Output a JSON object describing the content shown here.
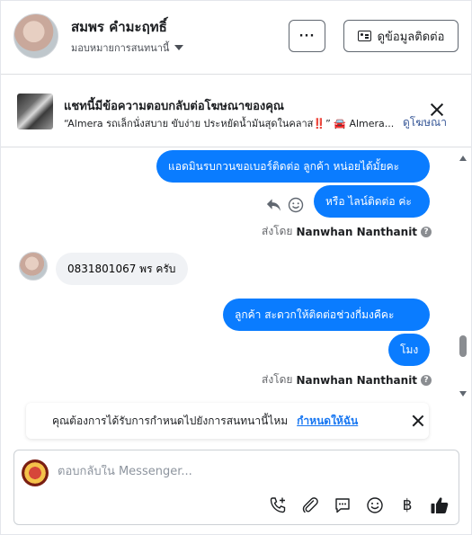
{
  "header": {
    "contact_name": "สมพร คํามะฤทธิ์",
    "assign_label": "มอบหมายการสนทนานี้",
    "more_label": "···",
    "contact_info_label": "ดูข้อมูลติดต่อ"
  },
  "ad": {
    "title": "แชทนี้มีข้อความตอบกลับต่อโฆษณาของคุณ",
    "text": "“Almera รถเล็กนั่งสบาย ขับง่าย ประหยัดน้ำมันสุดในคลาส‼️” 🚘 Almera...",
    "link": "ดูโฆษณา"
  },
  "messages": {
    "out1": "แอดมินรบกวนขอเบอร์ติดต่อ ลูกค้า หน่อยได้มั้ยคะ",
    "out2": "หรือ ไลน์ติดต่อ ค่ะ",
    "sent_prefix": "ส่งโดย",
    "sender": "Nanwhan Nanthanit",
    "in1": "0831801067 พร ครับ",
    "out3": "ลูกค้า  สะดวกให้ติดต่อช่วงกี่มงคืคะ",
    "out4": "โมง",
    "help": "?"
  },
  "prompt": {
    "text": "คุณต้องการได้รับการกำหนดไปยังการสนทนานี้ไหม",
    "link": "กำหนดให้ฉัน"
  },
  "composer": {
    "placeholder": "ตอบกลับใน Messenger...",
    "baht_symbol": "฿"
  },
  "colors": {
    "accent": "#0a7cff",
    "link": "#1877f2"
  }
}
